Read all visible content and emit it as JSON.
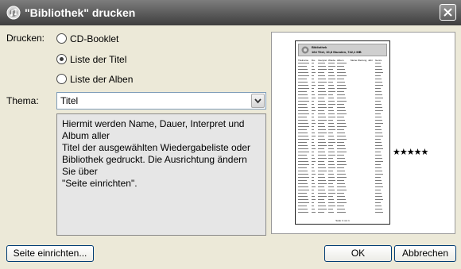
{
  "dialog": {
    "title": "\"Bibliothek\" drucken"
  },
  "print_section": {
    "label": "Drucken:",
    "options": [
      {
        "label": "CD-Booklet",
        "selected": false
      },
      {
        "label": "Liste der Titel",
        "selected": true
      },
      {
        "label": "Liste der Alben",
        "selected": false
      }
    ]
  },
  "theme": {
    "label": "Thema:",
    "value": "Titel",
    "description": "Hiermit werden Name, Dauer, Interpret und Album aller\nTitel der ausgewählten Wiedergabeliste oder\nBibliothek gedruckt. Die Ausrichtung ändern Sie über\n\"Seite einrichten\"."
  },
  "preview": {
    "header_title": "Bibliothek",
    "header_subtitle": "164 Titel, 10,8 Stunden, 742,1 MB",
    "columns": [
      "Titelname",
      "Da..",
      "Interpret",
      "Wiede..",
      "Album",
      "Meine Wertung",
      "Jahr",
      "Genre"
    ],
    "rating_stars": "★★★★★",
    "footer": "Seite 1 von 1"
  },
  "buttons": {
    "page_setup": "Seite einrichten...",
    "ok": "OK",
    "cancel": "Abbrechen"
  }
}
